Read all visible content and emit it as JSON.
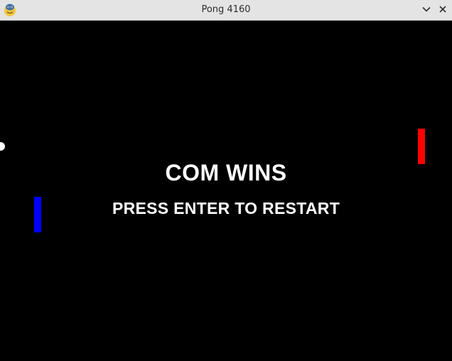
{
  "window": {
    "title": "Pong 4160",
    "app_icon": "python-logo-icon",
    "controls": {
      "minimize_icon": "chevron-down-icon",
      "close_icon": "close-icon"
    }
  },
  "game": {
    "background_color": "#000000",
    "winner_message": "COM WINS",
    "restart_prompt": "PRESS ENTER TO RESTART",
    "left_paddle_color": "#0000ff",
    "right_paddle_color": "#ff0000",
    "ball_color": "#ffffff"
  }
}
